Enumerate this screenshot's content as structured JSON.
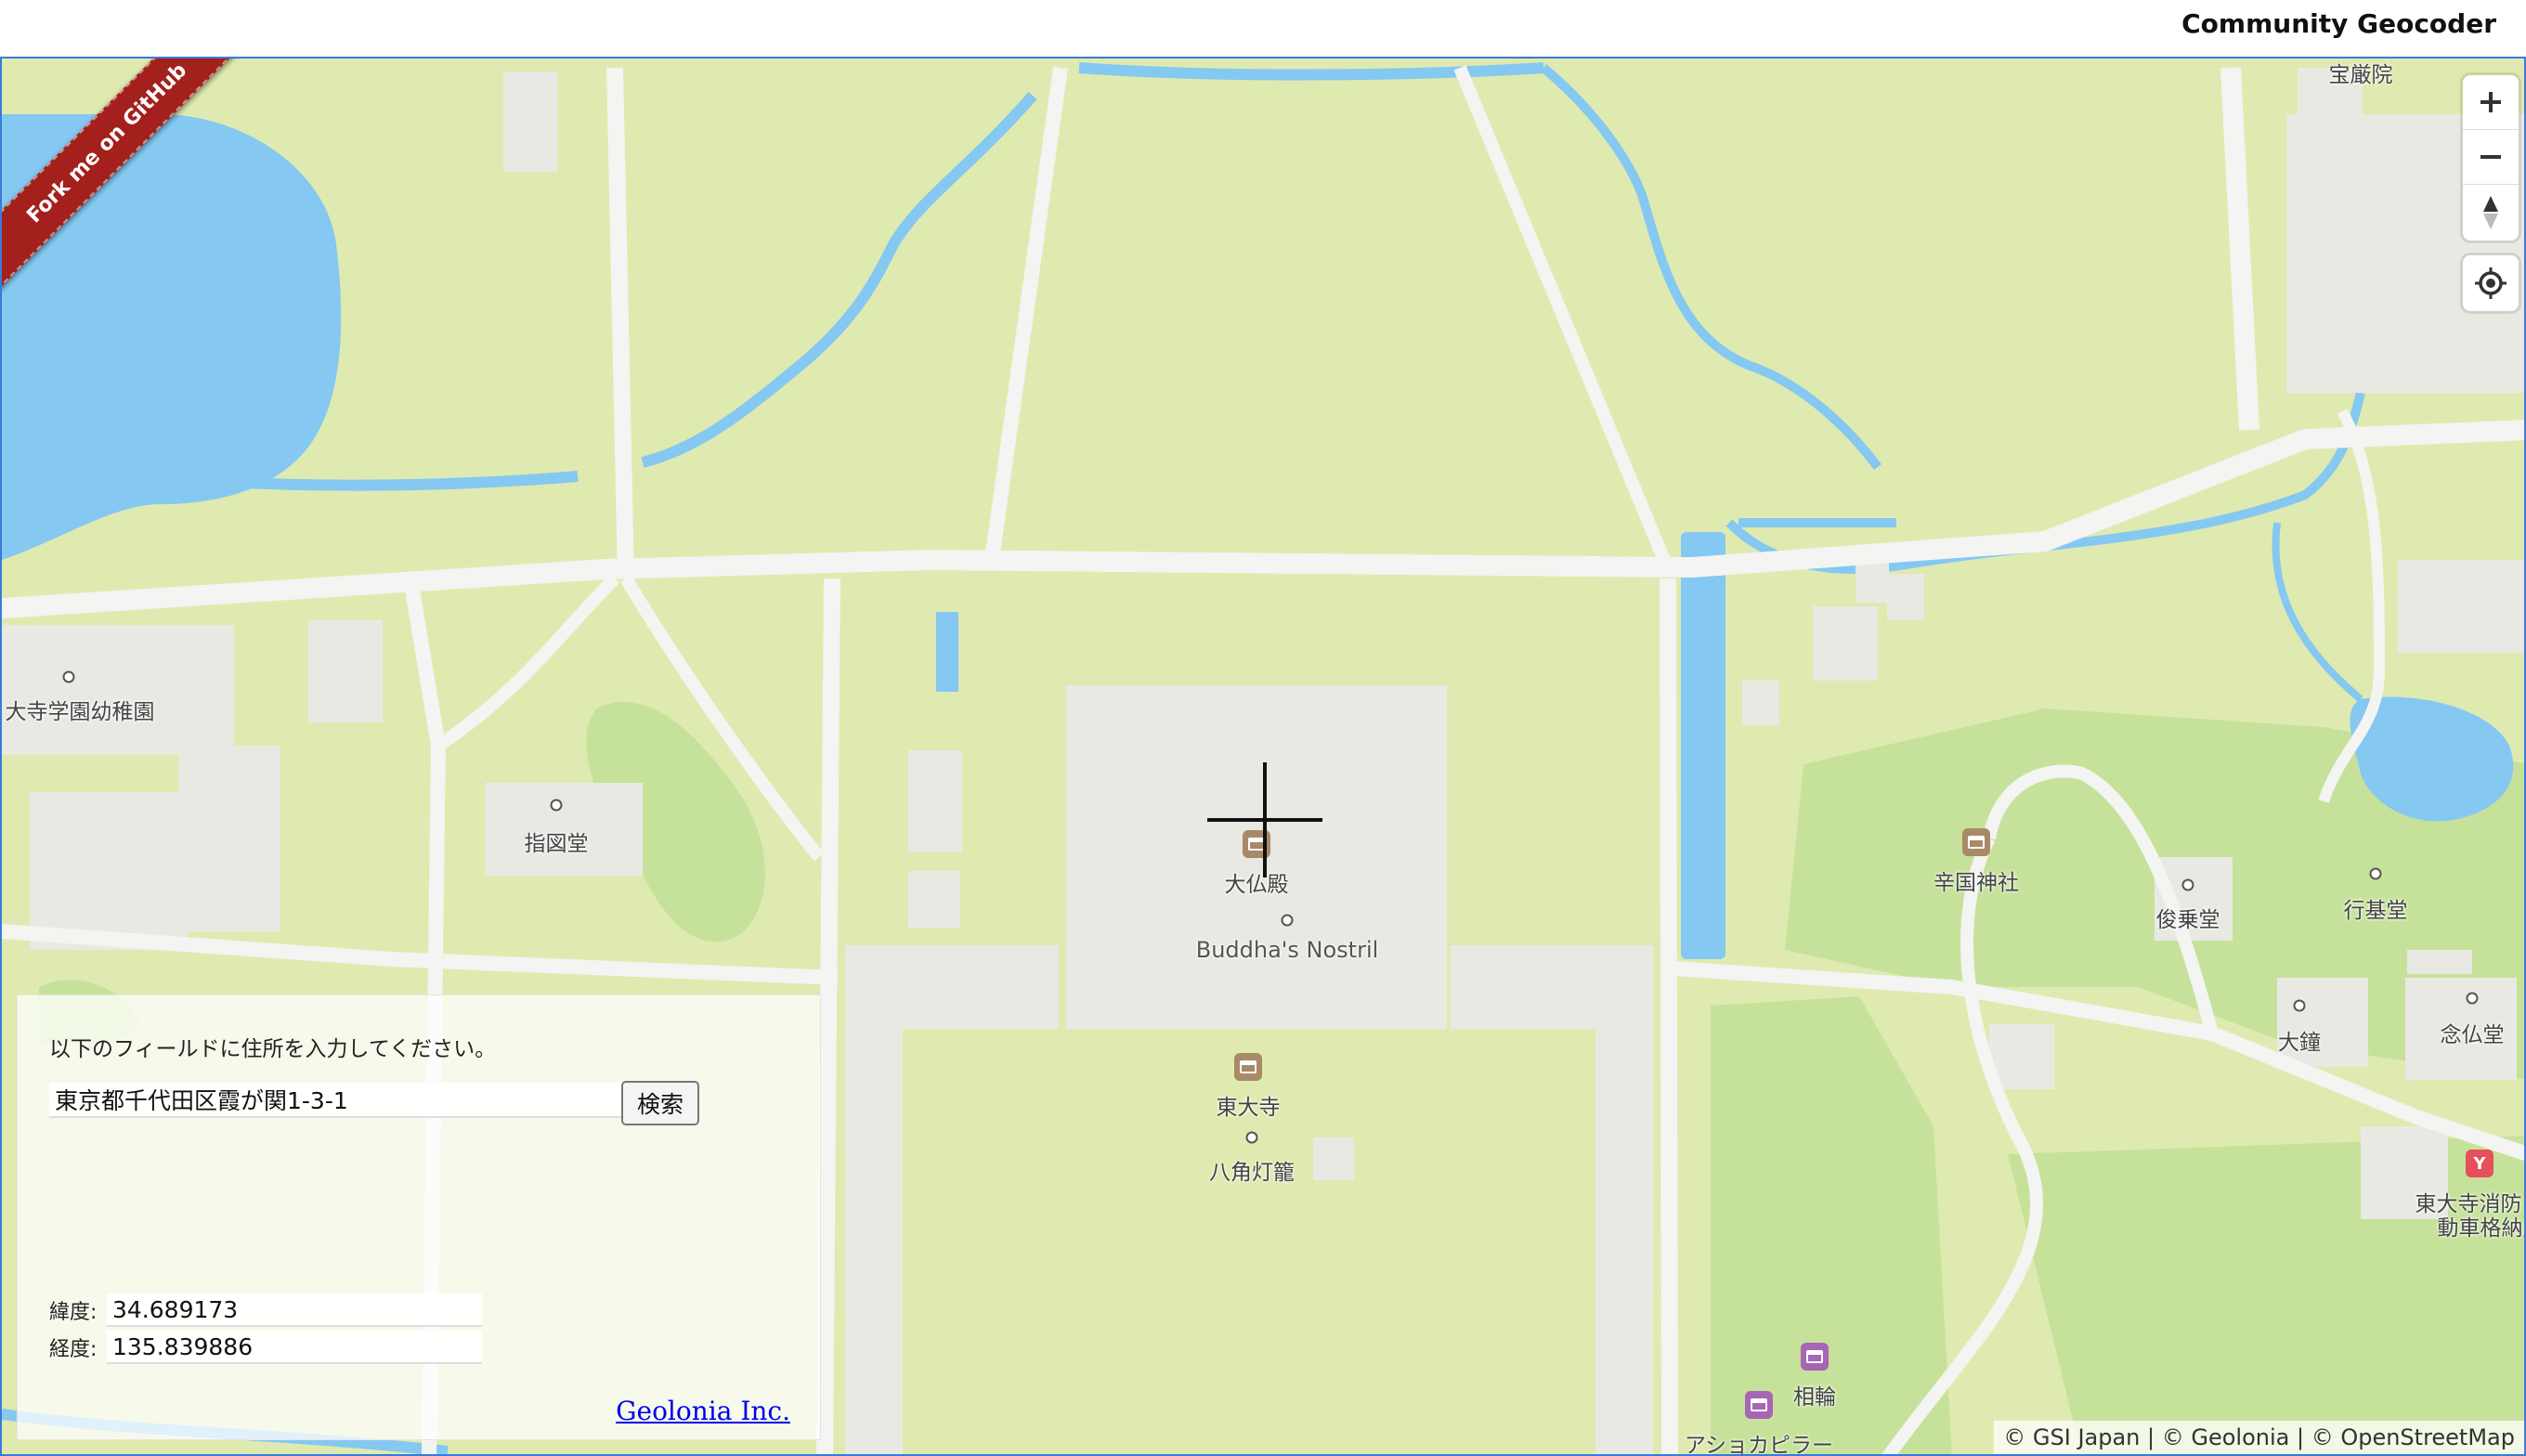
{
  "header": {
    "title": "Community Geocoder"
  },
  "ribbon": {
    "label": "Fork me on GitHub"
  },
  "map": {
    "labels": {
      "kindergarten": "大寺学園幼稚園",
      "shizudo": "指図堂",
      "daibutsuden": "大仏殿",
      "nostril": "Buddha's Nostril",
      "todaiji": "東大寺",
      "lantern": "八角灯籠",
      "hodenin": "宝厳院",
      "tsujikoku": "辛国神社",
      "shunjodo": "俊乗堂",
      "gyokido": "行基堂",
      "daisho": "大鐘",
      "nenbutsudo": "念仏堂",
      "firestation": "東大寺消防",
      "firestation2": "動車格納庫",
      "sorin": "相輪",
      "ashoka": "アショカピラー"
    },
    "colors": {
      "land": "#dfeab0",
      "park": "#c6e29a",
      "water": "#85c8f2",
      "road": "#f4f4f2",
      "building": "#e9e9e4"
    },
    "controls": {
      "zoom_in_icon": "plus-icon",
      "zoom_out_icon": "minus-icon",
      "compass_icon": "compass-icon",
      "geolocate_icon": "geolocate-icon"
    },
    "attribution": "© GSI Japan | © Geolonia | © OpenStreetMap"
  },
  "form": {
    "instruction": "以下のフィールドに住所を入力してください。",
    "address_value": "東京都千代田区霞が関1-3-1",
    "search_label": "検索",
    "lat_label": "緯度:",
    "lat_value": "34.689173",
    "lng_label": "経度:",
    "lng_value": "135.839886",
    "credit_link": "Geolonia Inc."
  }
}
